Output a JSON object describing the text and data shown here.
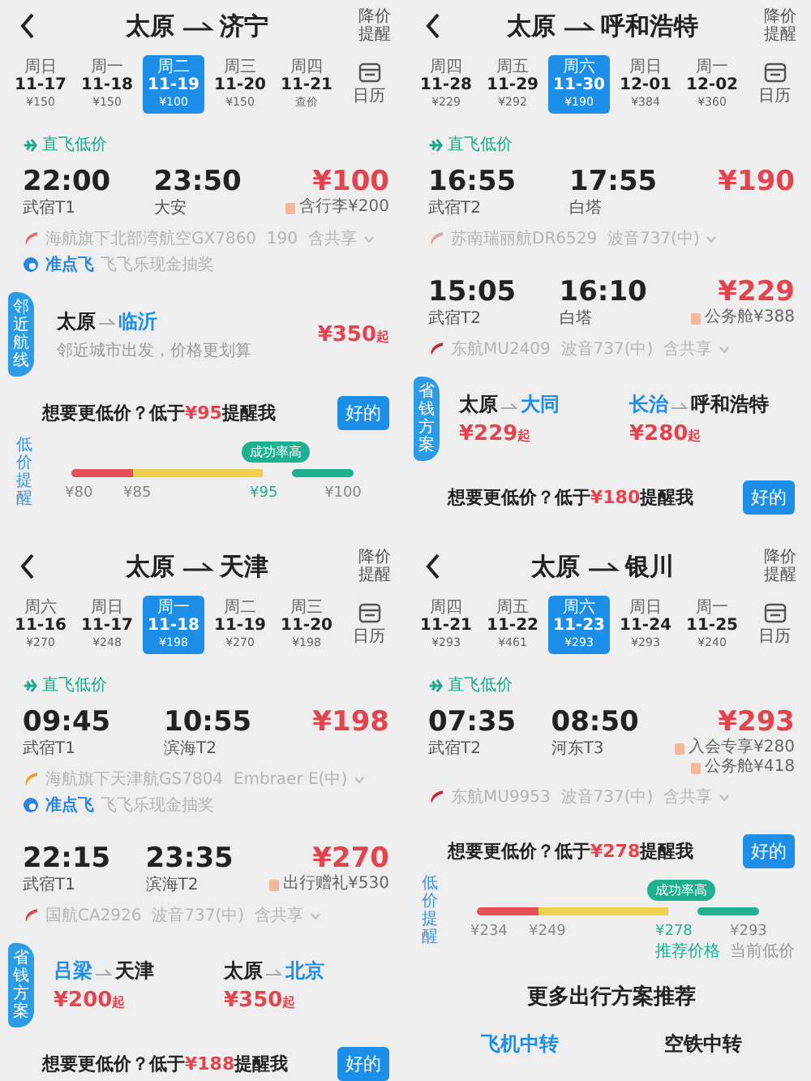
{
  "panels": [
    {
      "from": "太原",
      "to": "济宁",
      "alert": "降价提醒",
      "calendar": "日历",
      "dates": [
        {
          "weekday": "周日",
          "date": "11-17",
          "price": "¥150",
          "selected": false
        },
        {
          "weekday": "周一",
          "date": "11-18",
          "price": "¥150",
          "selected": false
        },
        {
          "weekday": "周二",
          "date": "11-19",
          "price": "¥100",
          "selected": true
        },
        {
          "weekday": "周三",
          "date": "11-20",
          "price": "¥150",
          "selected": false
        },
        {
          "weekday": "周四",
          "date": "11-21",
          "price": "查价",
          "selected": false
        }
      ],
      "sections": [
        {
          "kind": "tag",
          "text": "直飞低价"
        },
        {
          "kind": "flight",
          "dep_time": "22:00",
          "dep_airport": "武宿T1",
          "arr_time": "23:50",
          "arr_airport": "大安",
          "price": "¥100",
          "extras": [
            "含行李¥200"
          ],
          "airline": {
            "name": "海航旗下北部湾航空GX7860  190  含共享",
            "color": "#e07070"
          },
          "promo": {
            "label": "准点飞",
            "text": "飞飞乐现金抽奖"
          }
        },
        {
          "kind": "nearby",
          "label": "邻近航线",
          "from": "太原",
          "to": "临沂",
          "note": "邻近城市出发，价格更划算",
          "price": "¥350",
          "suffix": "起"
        },
        {
          "kind": "reminder",
          "prefix": "想要更低价？低于",
          "price": "¥95",
          "suffix": "提醒我",
          "button": "好的"
        },
        {
          "kind": "scale",
          "label": "低价提醒",
          "bubble": "成功率高",
          "ticks": [
            {
              "text": "¥80",
              "highlight": false
            },
            {
              "text": "¥85",
              "highlight": false
            },
            {
              "text": "¥95",
              "highlight": true
            },
            {
              "text": "¥100",
              "highlight": false
            }
          ]
        }
      ]
    },
    {
      "from": "太原",
      "to": "呼和浩特",
      "alert": "降价提醒",
      "calendar": "日历",
      "dates": [
        {
          "weekday": "周四",
          "date": "11-28",
          "price": "¥229",
          "selected": false
        },
        {
          "weekday": "周五",
          "date": "11-29",
          "price": "¥292",
          "selected": false
        },
        {
          "weekday": "周六",
          "date": "11-30",
          "price": "¥190",
          "selected": true
        },
        {
          "weekday": "周日",
          "date": "12-01",
          "price": "¥384",
          "selected": false
        },
        {
          "weekday": "周一",
          "date": "12-02",
          "price": "¥360",
          "selected": false
        }
      ],
      "sections": [
        {
          "kind": "tag",
          "text": "直飞低价"
        },
        {
          "kind": "flight",
          "dep_time": "16:55",
          "dep_airport": "武宿T2",
          "arr_time": "17:55",
          "arr_airport": "白塔",
          "price": "¥190",
          "airline": {
            "name": "苏南瑞丽航DR6529  波音737(中)",
            "color": "#d8a0a8"
          }
        },
        {
          "kind": "flight",
          "dep_time": "15:05",
          "dep_airport": "武宿T2",
          "arr_time": "16:10",
          "arr_airport": "白塔",
          "price": "¥229",
          "extras": [
            "公务舱¥388"
          ],
          "airline": {
            "name": "东航MU2409  波音737(中)  含共享",
            "color": "#c0283a"
          }
        },
        {
          "kind": "saver",
          "label": "省钱方案",
          "options": [
            {
              "from": "太原",
              "to": "大同",
              "from_highlighted": false,
              "to_highlighted": true,
              "price": "¥229",
              "suffix": "起"
            },
            {
              "from": "长治",
              "to": "呼和浩特",
              "from_highlighted": true,
              "to_highlighted": false,
              "price": "¥280",
              "suffix": "起"
            }
          ]
        },
        {
          "kind": "reminder",
          "prefix": "想要更低价？低于",
          "price": "¥180",
          "suffix": "提醒我",
          "button": "好的"
        }
      ]
    },
    {
      "from": "太原",
      "to": "天津",
      "alert": "降价提醒",
      "calendar": "日历",
      "dates": [
        {
          "weekday": "周六",
          "date": "11-16",
          "price": "¥270",
          "selected": false
        },
        {
          "weekday": "周日",
          "date": "11-17",
          "price": "¥248",
          "selected": false
        },
        {
          "weekday": "周一",
          "date": "11-18",
          "price": "¥198",
          "selected": true
        },
        {
          "weekday": "周二",
          "date": "11-19",
          "price": "¥270",
          "selected": false
        },
        {
          "weekday": "周三",
          "date": "11-20",
          "price": "¥198",
          "selected": false
        }
      ],
      "sections": [
        {
          "kind": "tag",
          "text": "直飞低价"
        },
        {
          "kind": "flight",
          "dep_time": "09:45",
          "dep_airport": "武宿T1",
          "arr_time": "10:55",
          "arr_airport": "滨海T2",
          "price": "¥198",
          "airline": {
            "name": "海航旗下天津航GS7804  Embraer E(中)",
            "color": "#e8a020"
          },
          "promo": {
            "label": "准点飞",
            "text": "飞飞乐现金抽奖"
          }
        },
        {
          "kind": "flight",
          "dep_time": "22:15",
          "dep_airport": "武宿T1",
          "arr_time": "23:35",
          "arr_airport": "滨海T2",
          "price": "¥270",
          "extras": [
            "出行赠礼¥530"
          ],
          "airline": {
            "name": "国航CA2926  波音737(中)  含共享",
            "color": "#e04848"
          }
        },
        {
          "kind": "saver",
          "label": "省钱方案",
          "options": [
            {
              "from": "吕梁",
              "to": "天津",
              "from_highlighted": true,
              "to_highlighted": false,
              "price": "¥200",
              "suffix": "起"
            },
            {
              "from": "太原",
              "to": "北京",
              "from_highlighted": false,
              "to_highlighted": true,
              "price": "¥350",
              "suffix": "起"
            }
          ]
        },
        {
          "kind": "reminder",
          "prefix": "想要更低价？低于",
          "price": "¥188",
          "suffix": "提醒我",
          "button": "好的"
        }
      ]
    },
    {
      "from": "太原",
      "to": "银川",
      "alert": "降价提醒",
      "calendar": "日历",
      "dates": [
        {
          "weekday": "周四",
          "date": "11-21",
          "price": "¥293",
          "selected": false
        },
        {
          "weekday": "周五",
          "date": "11-22",
          "price": "¥461",
          "selected": false
        },
        {
          "weekday": "周六",
          "date": "11-23",
          "price": "¥293",
          "selected": true
        },
        {
          "weekday": "周日",
          "date": "11-24",
          "price": "¥293",
          "selected": false
        },
        {
          "weekday": "周一",
          "date": "11-25",
          "price": "¥240",
          "selected": false
        }
      ],
      "sections": [
        {
          "kind": "tag",
          "text": "直飞低价"
        },
        {
          "kind": "flight",
          "dep_time": "07:35",
          "dep_airport": "武宿T2",
          "arr_time": "08:50",
          "arr_airport": "河东T3",
          "price": "¥293",
          "extras": [
            "入会专享¥280",
            "公务舱¥418"
          ],
          "airline": {
            "name": "东航MU9953  波音737(中)  含共享",
            "color": "#c0283a"
          }
        },
        {
          "kind": "reminder",
          "prefix": "想要更低价？低于",
          "price": "¥278",
          "suffix": "提醒我",
          "button": "好的"
        },
        {
          "kind": "scale",
          "label": "低价提醒",
          "bubble": "成功率高",
          "ticks": [
            {
              "text": "¥234",
              "highlight": false
            },
            {
              "text": "¥249",
              "highlight": false
            },
            {
              "text": "¥278",
              "highlight": true,
              "caption": "推荐价格"
            },
            {
              "text": "¥293",
              "highlight": false,
              "caption": "当前低价"
            }
          ]
        },
        {
          "kind": "heading",
          "text": "更多出行方案推荐"
        },
        {
          "kind": "tabs",
          "tabs": [
            {
              "label": "飞机中转",
              "selected": true
            },
            {
              "label": "空铁中转",
              "selected": false
            }
          ]
        }
      ]
    }
  ]
}
